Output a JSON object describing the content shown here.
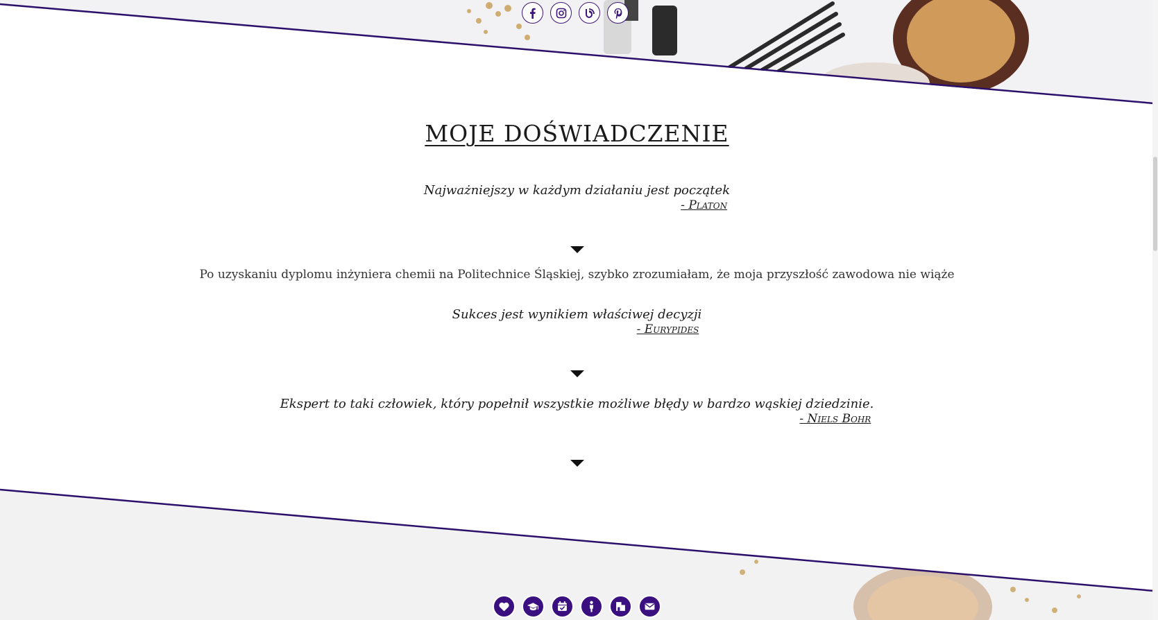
{
  "social": [
    {
      "name": "facebook-icon"
    },
    {
      "name": "instagram-icon"
    },
    {
      "name": "blog-icon"
    },
    {
      "name": "pinterest-icon"
    }
  ],
  "section": {
    "title": "MOJE DOŚWIADCZENIE"
  },
  "quotes": [
    {
      "text": "Najważniejszy w każdym działaniu jest początek",
      "author": "- Platon"
    },
    {
      "text": "Sukces jest wynikiem właściwej decyzji",
      "author": "- Eurypides"
    },
    {
      "text": "Ekspert to taki człowiek, który popełnił wszystkie możliwe błędy w bardzo wąskiej dziedzinie.",
      "author": "- Niels Bohr"
    }
  ],
  "body_text": "Po uzyskaniu dyplomu inżyniera chemii na Politechnice Śląskiej, szybko zrozumiałam, że moja przyszłość zawodowa nie wiąże",
  "bottom_nav": [
    {
      "name": "heart-icon"
    },
    {
      "name": "graduation-cap-icon"
    },
    {
      "name": "calendar-check-icon"
    },
    {
      "name": "person-icon"
    },
    {
      "name": "building-icon"
    },
    {
      "name": "envelope-icon"
    }
  ],
  "colors": {
    "accent": "#3a0f80",
    "line": "#2b0f6b",
    "text": "#1a1a1a"
  }
}
